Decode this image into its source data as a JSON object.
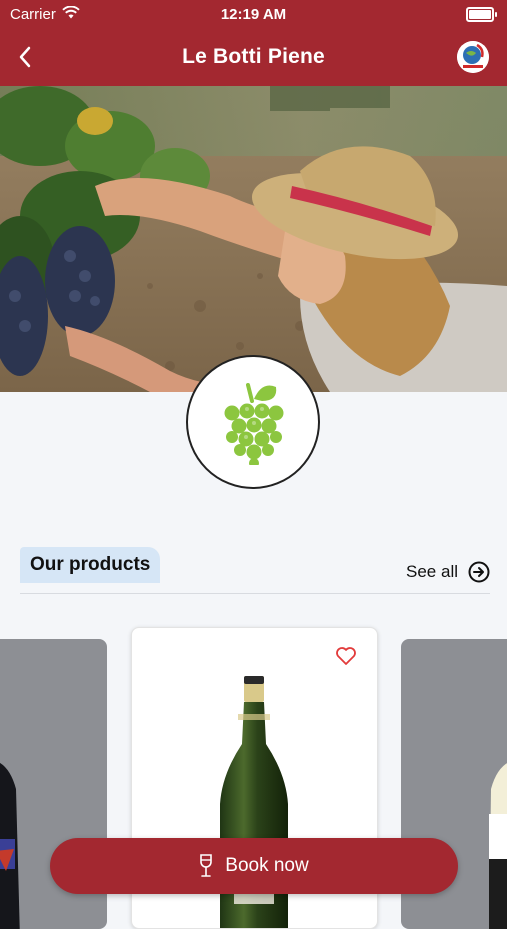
{
  "status_bar": {
    "carrier": "Carrier",
    "time": "12:19 AM"
  },
  "nav": {
    "title": "Le Botti Piene"
  },
  "section": {
    "title": "Our products",
    "see_all": "See all"
  },
  "cta": {
    "label": "Book now"
  },
  "colors": {
    "brand": "#a32830",
    "section_tag": "#d6e6f6",
    "grape": "#8cc63f",
    "heart": "#e23b3b"
  }
}
